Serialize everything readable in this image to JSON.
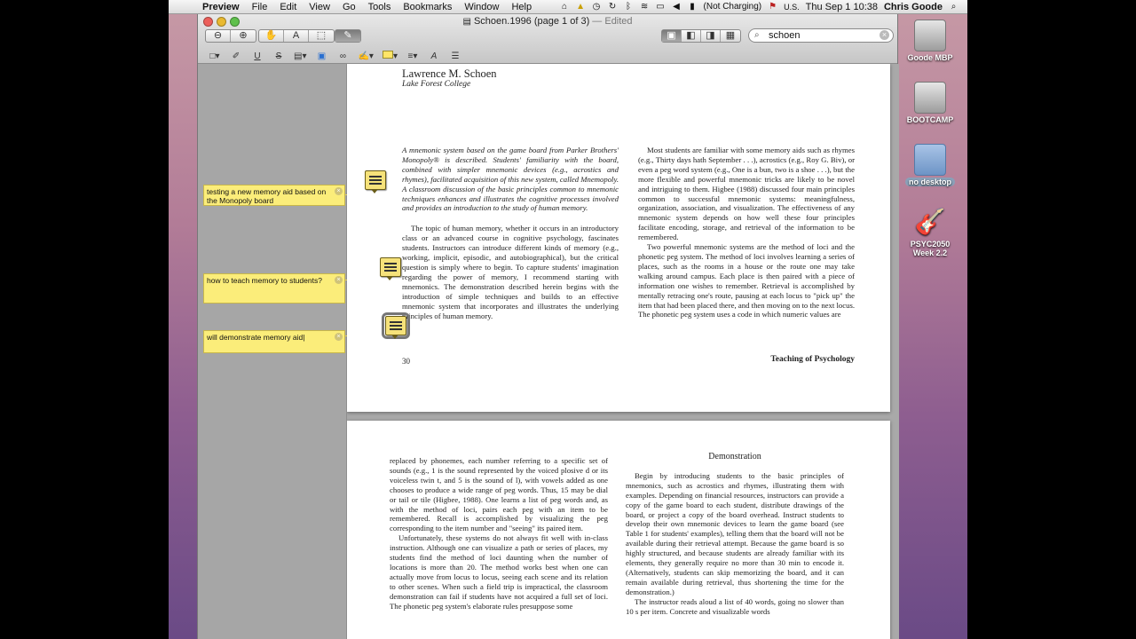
{
  "menubar": {
    "app": "Preview",
    "items": [
      "File",
      "Edit",
      "View",
      "Go",
      "Tools",
      "Bookmarks",
      "Window",
      "Help"
    ],
    "battery": "(Not Charging)",
    "input": "U.S.",
    "clock": "Thu Sep 1  10:38",
    "user": "Chris Goode"
  },
  "desktop": {
    "icons": [
      {
        "label": "Goode MBP"
      },
      {
        "label": "BOOTCAMP"
      },
      {
        "label": "no desktop"
      },
      {
        "label": "PSYC2050 Week 2.2"
      }
    ]
  },
  "window": {
    "title": "Schoen.1996 (page 1 of 3)",
    "edited": "— Edited",
    "search_value": "schoen"
  },
  "notes": [
    {
      "text": "testing a new memory aid based on the Monopoly board"
    },
    {
      "text": "how to teach memory to students?"
    },
    {
      "text": "will demonstrate memory aid"
    }
  ],
  "page1": {
    "author": "Lawrence M. Schoen",
    "affiliation": "Lake Forest College",
    "abstract": "A mnemonic system based on the game board from Parker Brothers' Monopoly® is described. Students' familiarity with the board, combined with simpler mnemonic devices (e.g., acrostics and rhymes), facilitated acquisition of this new system, called Mnemopoly. A classroom discussion of the basic principles common to mnemonic techniques enhances and illustrates the cognitive processes involved and provides an introduction to the study of human memory.",
    "left_p1": "The topic of human memory, whether it occurs in an introductory class or an advanced course in cognitive psychology, fascinates students. Instructors can introduce different kinds of memory (e.g., working, implicit, episodic, and autobiographical), but the critical question is simply where to begin. To capture students' imagination regarding the power of memory, I recommend starting with mnemonics. The demonstration described herein begins with the introduction of simple techniques and builds to an effective mnemonic system that incorporates and illustrates the underlying principles of human memory.",
    "right_p1": "Most students are familiar with some memory aids such as rhymes (e.g., Thirty days hath September . . .), acrostics (e.g., Roy G. Biv), or even a peg word system (e.g., One is a bun, two is a shoe . . .), but the more flexible and powerful mnemonic tricks are likely to be novel and intriguing to them. Higbee (1988) discussed four main principles common to successful mnemonic systems: meaningfulness, organization, association, and visualization. The effectiveness of any mnemonic system depends on how well these four principles facilitate encoding, storage, and retrieval of the information to be remembered.",
    "right_p2": "Two powerful mnemonic systems are the method of loci and the phonetic peg system. The method of loci involves learning a series of places, such as the rooms in a house or the route one may take walking around campus. Each place is then paired with a piece of information one wishes to remember. Retrieval is accomplished by mentally retracing one's route, pausing at each locus to \"pick up\" the item that had been placed there, and then moving on to the next locus. The phonetic peg system uses a code in which numeric values are",
    "page_number": "30",
    "journal": "Teaching of Psychology"
  },
  "page2": {
    "left_p1": "replaced by phonemes, each number referring to a specific set of sounds (e.g., 1 is the sound represented by the voiced plosive d or its voiceless twin t, and 5 is the sound of l), with vowels added as one chooses to produce a wide range of peg words. Thus, 15 may be dial or tail or tile (Higbee, 1988). One learns a list of peg words and, as with the method of loci, pairs each peg with an item to be remembered. Recall is accomplished by visualizing the peg corresponding to the item number and \"seeing\" its paired item.",
    "left_p2": "Unfortunately, these systems do not always fit well with in-class instruction. Although one can visualize a path or series of places, my students find the method of loci daunting when the number of locations is more than 20. The method works best when one can actually move from locus to locus, seeing each scene and its relation to other scenes. When such a field trip is impractical, the classroom demonstration can fail if students have not acquired a full set of loci. The phonetic peg system's elaborate rules presuppose some",
    "heading": "Demonstration",
    "right_p1": "Begin by introducing students to the basic principles of mnemonics, such as acrostics and rhymes, illustrating them with examples. Depending on financial resources, instructors can provide a copy of the game board to each student, distribute drawings of the board, or project a copy of the board overhead. Instruct students to develop their own mnemonic devices to learn the game board (see Table 1 for students' examples), telling them that the board will not be available during their retrieval attempt. Because the game board is so highly structured, and because students are already familiar with its elements, they generally require no more than 30 min to encode it. (Alternatively, students can skip memorizing the board, and it can remain available during retrieval, thus shortening the time for the demonstration.)",
    "right_p2": "The instructor reads aloud a list of 40 words, going no slower than 10 s per item. Concrete and visualizable words"
  }
}
